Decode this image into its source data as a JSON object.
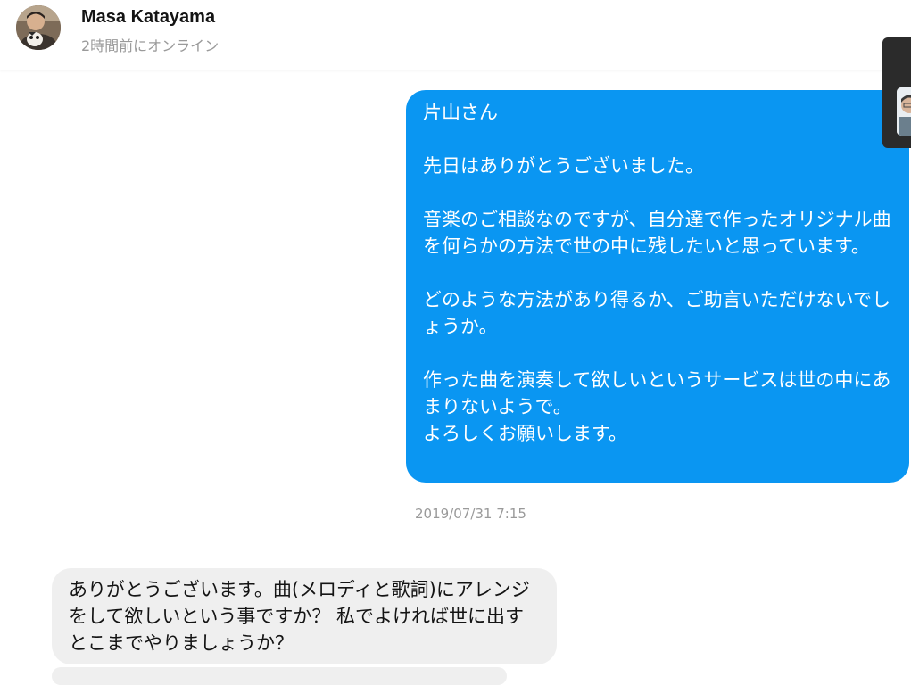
{
  "header": {
    "user_name": "Masa Katayama",
    "status": "2時間前にオンライン"
  },
  "messages": [
    {
      "direction": "sent",
      "text": "片山さん\n\n先日はありがとうございました。\n\n音楽のご相談なのですが、自分達で作ったオリジナル曲を何らかの方法で世の中に残したいと思っています。\n\nどのような方法があり得るか、ご助言いただけないでしょうか。\n\n作った曲を演奏して欲しいというサービスは世の中にあまりないようで。\nよろしくお願いします。"
    },
    {
      "direction": "timestamp",
      "text": "2019/07/31 7:15"
    },
    {
      "direction": "received",
      "text": "ありがとうございます。曲(メロディと歌詞)にアレンジをして欲しいという事ですか？ 私でよければ世に出すとこまでやりましょうか？"
    }
  ],
  "colors": {
    "sent_bubble": "#0a96f2",
    "received_bubble": "#efefef",
    "status_text": "#9a9a9a"
  },
  "icons": {
    "avatar": "user-avatar-photo",
    "video_thumbnail": "video-call-thumbnail"
  }
}
